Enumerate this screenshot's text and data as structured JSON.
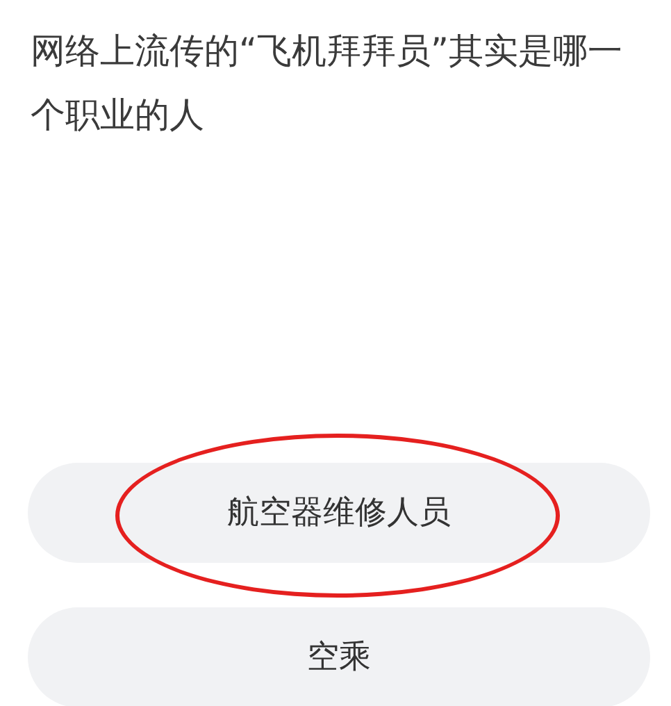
{
  "question": "网络上流传的“飞机拜拜员”其实是哪一个职业的人",
  "options": [
    {
      "label": "航空器维修人员",
      "circled": true
    },
    {
      "label": "空乘",
      "circled": false
    }
  ]
}
